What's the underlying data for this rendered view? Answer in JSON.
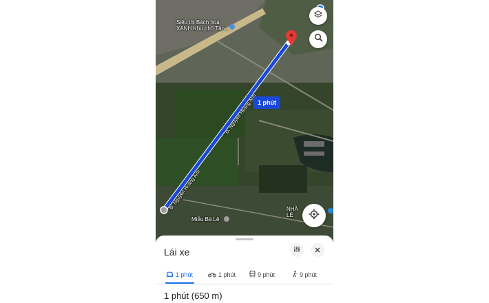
{
  "map": {
    "poi_top": [
      "Siêu thị Bách hoá",
      "XANH Khu phố Tân..."
    ],
    "poi_bottom": "Miễu Bà Lê",
    "poi_right": [
      "NHÀ",
      "LÊ"
    ],
    "road_label_1": "Đ. Nguyễn Hoàng Anh",
    "road_label_2": "Đ. Nguyễn Hoàng Anh",
    "route_time": "1 phút",
    "route_color": "#1a49d8"
  },
  "icons": {
    "layers": "layers-icon",
    "search": "search-icon",
    "locate": "my-location-icon",
    "filter": "tune-icon",
    "close": "close-icon"
  },
  "sheet": {
    "title": "Lái xe",
    "tabs": [
      {
        "label": "1 phút",
        "mode": "car"
      },
      {
        "label": "1 phút",
        "mode": "motorbike"
      },
      {
        "label": "9 phút",
        "mode": "transit"
      },
      {
        "label": "9 phút",
        "mode": "walk"
      }
    ],
    "summary": "1 phút (650 m)"
  }
}
